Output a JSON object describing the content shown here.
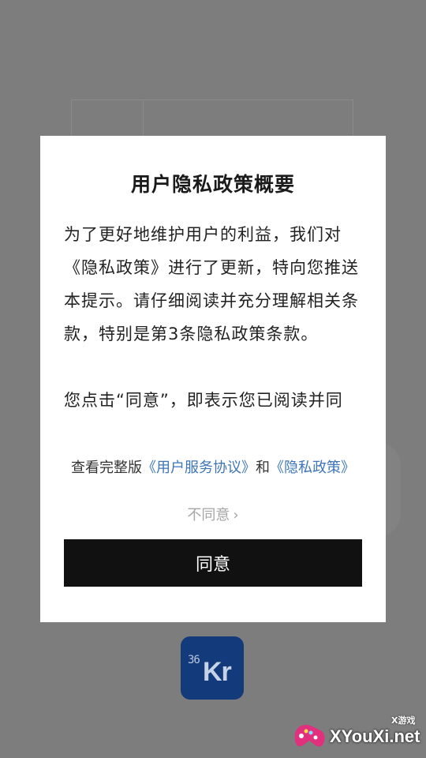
{
  "dialog": {
    "title": "用户隐私政策概要",
    "paragraphs": [
      "为了更好地维护用户的利益，我们对《隐私政策》进行了更新，特向您推送本提示。请仔细阅读并充分理解相关条款，特别是第3条隐私政策条款。",
      "您点击“同意”，即表示您已阅读并同"
    ],
    "links_prefix": "查看完整版",
    "user_agreement_link": "《用户服务协议》",
    "links_joiner": "和",
    "privacy_policy_link": "《隐私政策》",
    "disagree_label": "不同意",
    "disagree_chevron": "›",
    "agree_label": "同意"
  },
  "app_logo": {
    "small_text": "36",
    "big_text": "Kr",
    "background_color": "#133a7a"
  },
  "watermark": {
    "brand": "XYouXi.net",
    "tag": "X游戏",
    "icon": "gamepad-icon"
  },
  "colors": {
    "overlay": "#7d7d7d",
    "link": "#3d75b8",
    "button": "#111111",
    "disagree_text": "#a6a6a6"
  }
}
